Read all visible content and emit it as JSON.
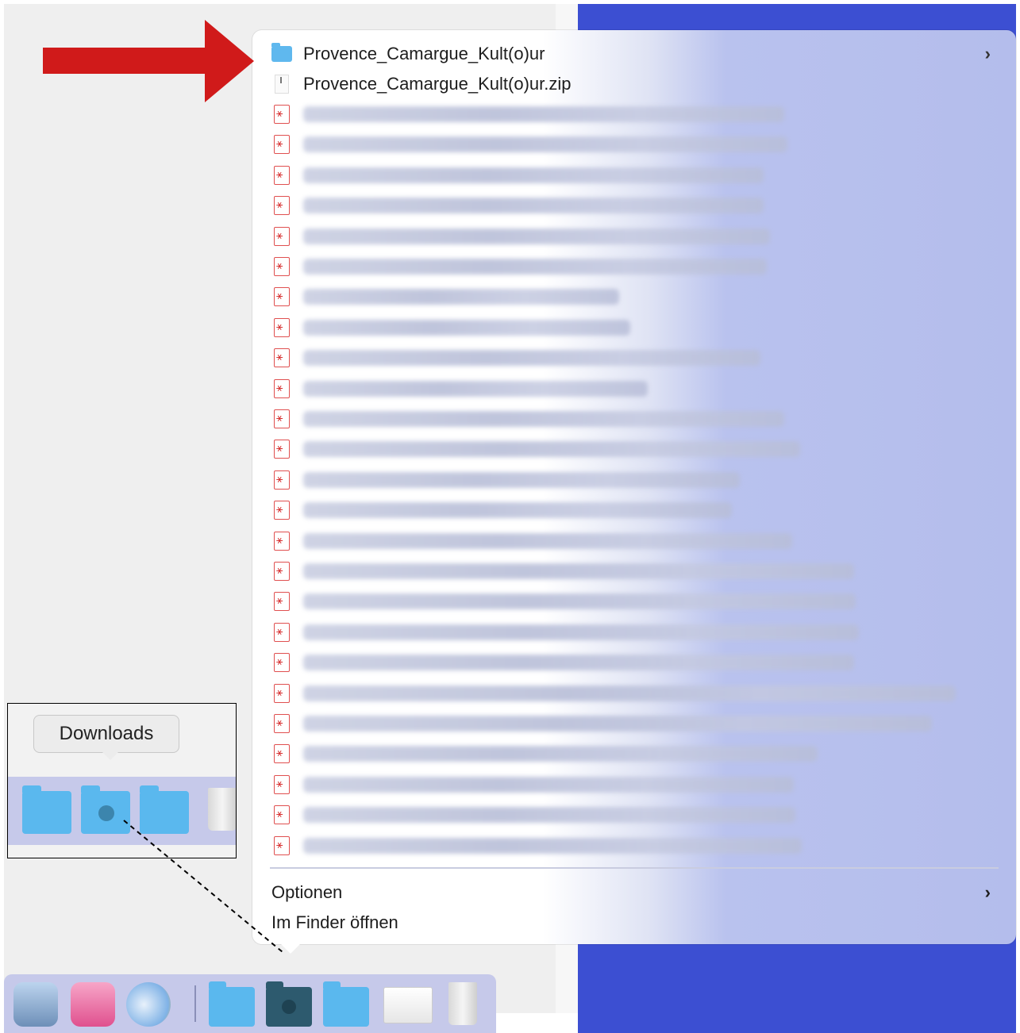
{
  "stack_menu": {
    "items": [
      {
        "label": "Provence_Camargue_Kult(o)ur",
        "kind": "folder",
        "has_submenu": true
      },
      {
        "label": "Provence_Camargue_Kult(o)ur.zip",
        "kind": "zip",
        "has_submenu": false
      }
    ],
    "blurred_pdf_count": 25,
    "options_label": "Optionen",
    "open_in_finder_label": "Im Finder öffnen"
  },
  "inset": {
    "tooltip": "Downloads"
  },
  "colors": {
    "arrow": "#d01a1a",
    "desktop": "#3c4fd2",
    "folder": "#5ab8ee"
  },
  "icons": {
    "submenu": "chevron-right-icon",
    "pdf": "pdf-file-icon",
    "folder": "folder-icon",
    "zip": "zip-file-icon"
  }
}
